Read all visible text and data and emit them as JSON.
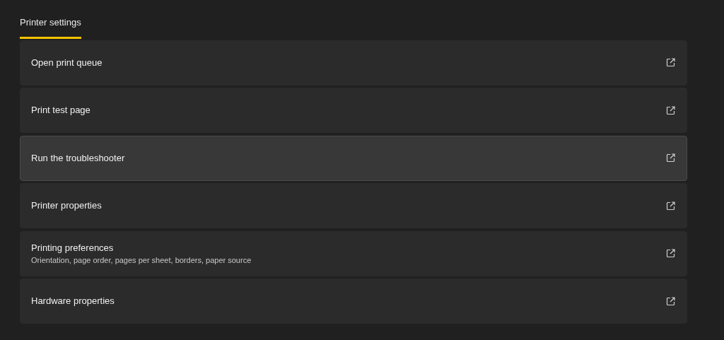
{
  "tabs": [
    {
      "label": "Printer settings",
      "selected": true
    }
  ],
  "items": [
    {
      "title": "Open print queue",
      "selected": false
    },
    {
      "title": "Print test page",
      "selected": false
    },
    {
      "title": "Run the troubleshooter",
      "selected": true
    },
    {
      "title": "Printer properties",
      "selected": false
    },
    {
      "title": "Printing preferences",
      "subtitle": "Orientation, page order, pages per sheet, borders, paper source",
      "selected": false
    },
    {
      "title": "Hardware properties",
      "selected": false
    }
  ]
}
